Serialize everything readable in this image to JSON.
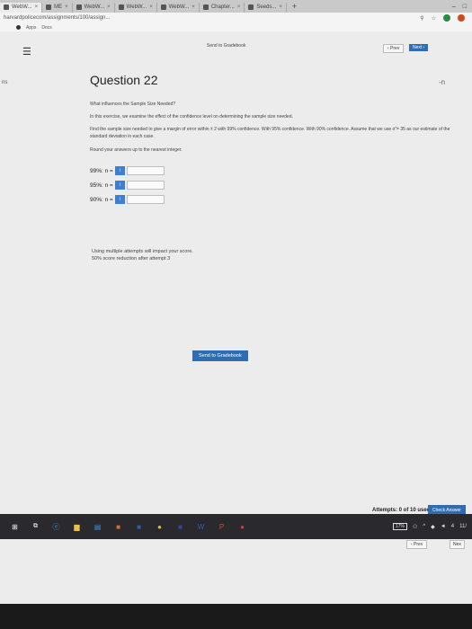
{
  "browser": {
    "tabs": [
      {
        "label": "WebW..."
      },
      {
        "label": "ME"
      },
      {
        "label": "WebW..."
      },
      {
        "label": "WebW..."
      },
      {
        "label": "WebW..."
      },
      {
        "label": "Chapter..."
      },
      {
        "label": "Seeds..."
      }
    ],
    "url": "harvardpolicecom/assignments/100/assign...",
    "bookmarks": [
      "Apps",
      "Docs"
    ]
  },
  "nav": {
    "send_to_gradebook_top": "Send to Gradebook",
    "prev_top": "‹ Prev",
    "next_top": "Next ›"
  },
  "question": {
    "title": "Question 22",
    "subtitle": "What influences the Sample Size Needed?",
    "intro": "In this exercise, we examine the effect of the confidence level on determining the sample size needed.",
    "instruction_line1": "Find the sample size needed to give a margin of error within ± 2 with 99% confidence. With 95% confidence. With 90% confidence. Assume that we use σ̃ = 35 as our estimate of the",
    "instruction_line2": "standard deviation in each case.",
    "round_note": "Round your answers up to the nearest integer.",
    "rows": [
      {
        "label": "99%: n =",
        "icon": "i"
      },
      {
        "label": "95%: n =",
        "icon": "i"
      },
      {
        "label": "90%: n =",
        "icon": "i"
      }
    ],
    "attempts_note_line1": "Using multiple attempts will impact your score.",
    "attempts_note_line2": "50% score reduction after attempt 3"
  },
  "bottom": {
    "send_to_gradebook": "Send to Gradebook",
    "attempts": "Attempts: 0 of 10 used",
    "check_answer": "Check Answer",
    "prev": "‹ Prev",
    "next": "Nex"
  },
  "edge": {
    "left": "ns",
    "right": "-n"
  },
  "taskbar": {
    "battery": "17%",
    "clock_time": "4",
    "clock_date": "11/"
  },
  "colors": {
    "accent": "#2f6db3",
    "input_icon": "#3e7fd0"
  }
}
